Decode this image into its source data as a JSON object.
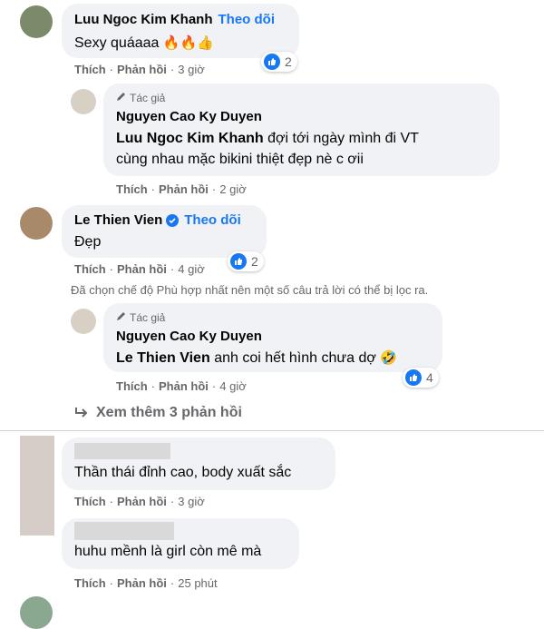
{
  "comments": [
    {
      "name": "Luu Ngoc Kim Khanh",
      "follow": "Theo dõi",
      "text": "Sexy quáaaa",
      "emojis": "🔥🔥👍",
      "like": "Thích",
      "reply": "Phản hồi",
      "time": "3 giờ",
      "reactions": "2"
    },
    {
      "author_tag": "Tác giả",
      "name": "Nguyen Cao Ky Duyen",
      "mention": "Luu Ngoc Kim Khanh",
      "text_line1": "đợi tới ngày mình đi VT",
      "text_line2": "cùng nhau mặc bikini thiệt đẹp nè c ơii",
      "like": "Thích",
      "reply": "Phản hồi",
      "time": "2 giờ"
    },
    {
      "name": "Le Thien Vien",
      "follow": "Theo dõi",
      "text": "Đẹp",
      "like": "Thích",
      "reply": "Phản hồi",
      "time": "4 giờ",
      "reactions": "2"
    },
    {
      "author_tag": "Tác giả",
      "name": "Nguyen Cao Ky Duyen",
      "mention": "Le Thien Vien",
      "text": "anh coi hết hình chưa dợ",
      "emoji": "🤣",
      "like": "Thích",
      "reply": "Phản hồi",
      "time": "4 giờ",
      "reactions": "4"
    },
    {
      "text": "Thần thái đỉnh cao, body xuất sắc",
      "like": "Thích",
      "reply": "Phản hồi",
      "time": "3 giờ"
    },
    {
      "text": "huhu mềnh là girl còn mê mà",
      "like": "Thích",
      "reply": "Phản hồi",
      "time": "25 phút"
    }
  ],
  "filter_notice": "Đã chọn chế độ Phù hợp nhất nên một số câu trả lời có thể bị lọc ra.",
  "more_replies": "Xem thêm 3 phản hồi",
  "separator": "·",
  "colors": {
    "accent": "#1877f2",
    "bubble": "#f0f2f5",
    "meta": "#65676b"
  }
}
